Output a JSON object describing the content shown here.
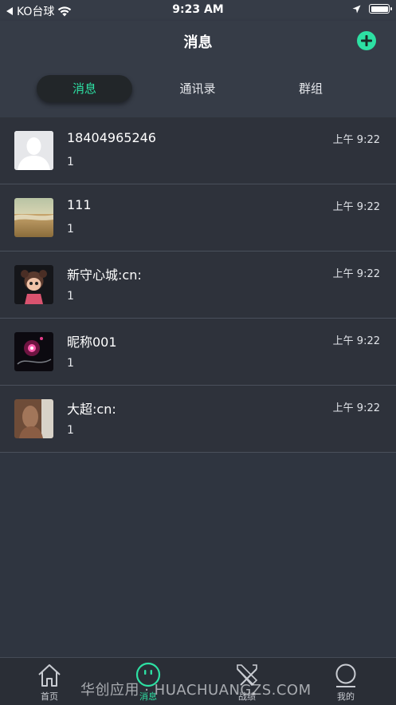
{
  "status_bar": {
    "back_label": "KO台球",
    "time": "9:23 AM"
  },
  "header": {
    "title": "消息",
    "tabs": [
      {
        "label": "消息",
        "active": true
      },
      {
        "label": "通讯录",
        "active": false
      },
      {
        "label": "群组",
        "active": false
      }
    ]
  },
  "conversations": [
    {
      "name": "18404965246",
      "preview": "1",
      "time": "上午 9:22",
      "avatar": "default-person-icon"
    },
    {
      "name": "111",
      "preview": "1",
      "time": "上午 9:22",
      "avatar": "beach-photo"
    },
    {
      "name": "新守心城:cn:",
      "preview": "1",
      "time": "上午 9:22",
      "avatar": "cartoon-girl-photo"
    },
    {
      "name": "昵称001",
      "preview": "1",
      "time": "上午 9:22",
      "avatar": "neon-night-photo"
    },
    {
      "name": "大超:cn:",
      "preview": "1",
      "time": "上午 9:22",
      "avatar": "portrait-photo"
    }
  ],
  "tab_bar": {
    "items": [
      {
        "label": "首页",
        "icon": "home-icon",
        "active": false
      },
      {
        "label": "消息",
        "icon": "chat-icon",
        "active": true
      },
      {
        "label": "战绩",
        "icon": "record-icon",
        "active": false
      },
      {
        "label": "我的",
        "icon": "profile-icon",
        "active": false
      }
    ]
  },
  "watermark": "华创应用 · HUACHUANGZS.COM",
  "colors": {
    "accent": "#2de0a3",
    "background": "#2f3540",
    "header": "#363c47"
  }
}
